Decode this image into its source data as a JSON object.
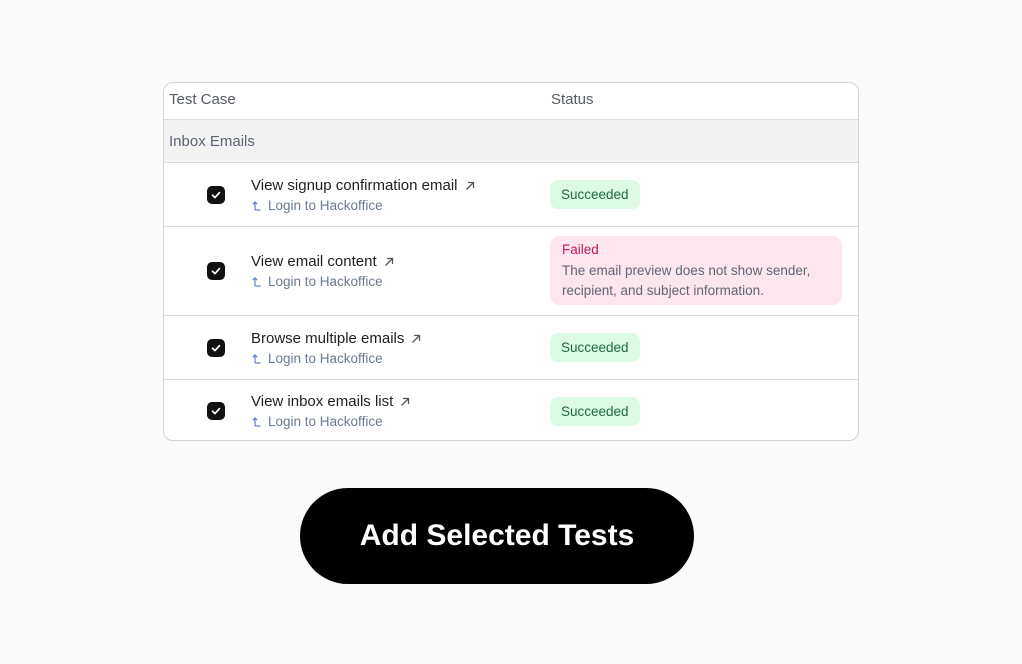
{
  "table": {
    "headers": {
      "test_case": "Test Case",
      "status": "Status"
    },
    "group_label": "Inbox Emails",
    "rows": [
      {
        "title": "View signup confirmation email",
        "dependency": "Login to Hackoffice",
        "status": "Succeeded",
        "checked": true
      },
      {
        "title": "View email content",
        "dependency": "Login to Hackoffice",
        "status": "Failed",
        "status_message": "The email preview does not show sender, recipient, and subject information.",
        "checked": true
      },
      {
        "title": "Browse multiple emails",
        "dependency": "Login to Hackoffice",
        "status": "Succeeded",
        "checked": true
      },
      {
        "title": "View inbox emails list",
        "dependency": "Login to Hackoffice",
        "status": "Succeeded",
        "checked": true
      }
    ]
  },
  "cta": {
    "label": "Add Selected Tests"
  },
  "icons": {
    "checkbox": "checkbox-checked-icon",
    "external": "arrow-up-right-icon",
    "dependency": "corner-up-left-icon"
  },
  "colors": {
    "success_bg": "#dcfae4",
    "success_text": "#1e6b3a",
    "fail_bg": "#fde6ee",
    "fail_text": "#c2185b",
    "cta_bg": "#000000"
  }
}
